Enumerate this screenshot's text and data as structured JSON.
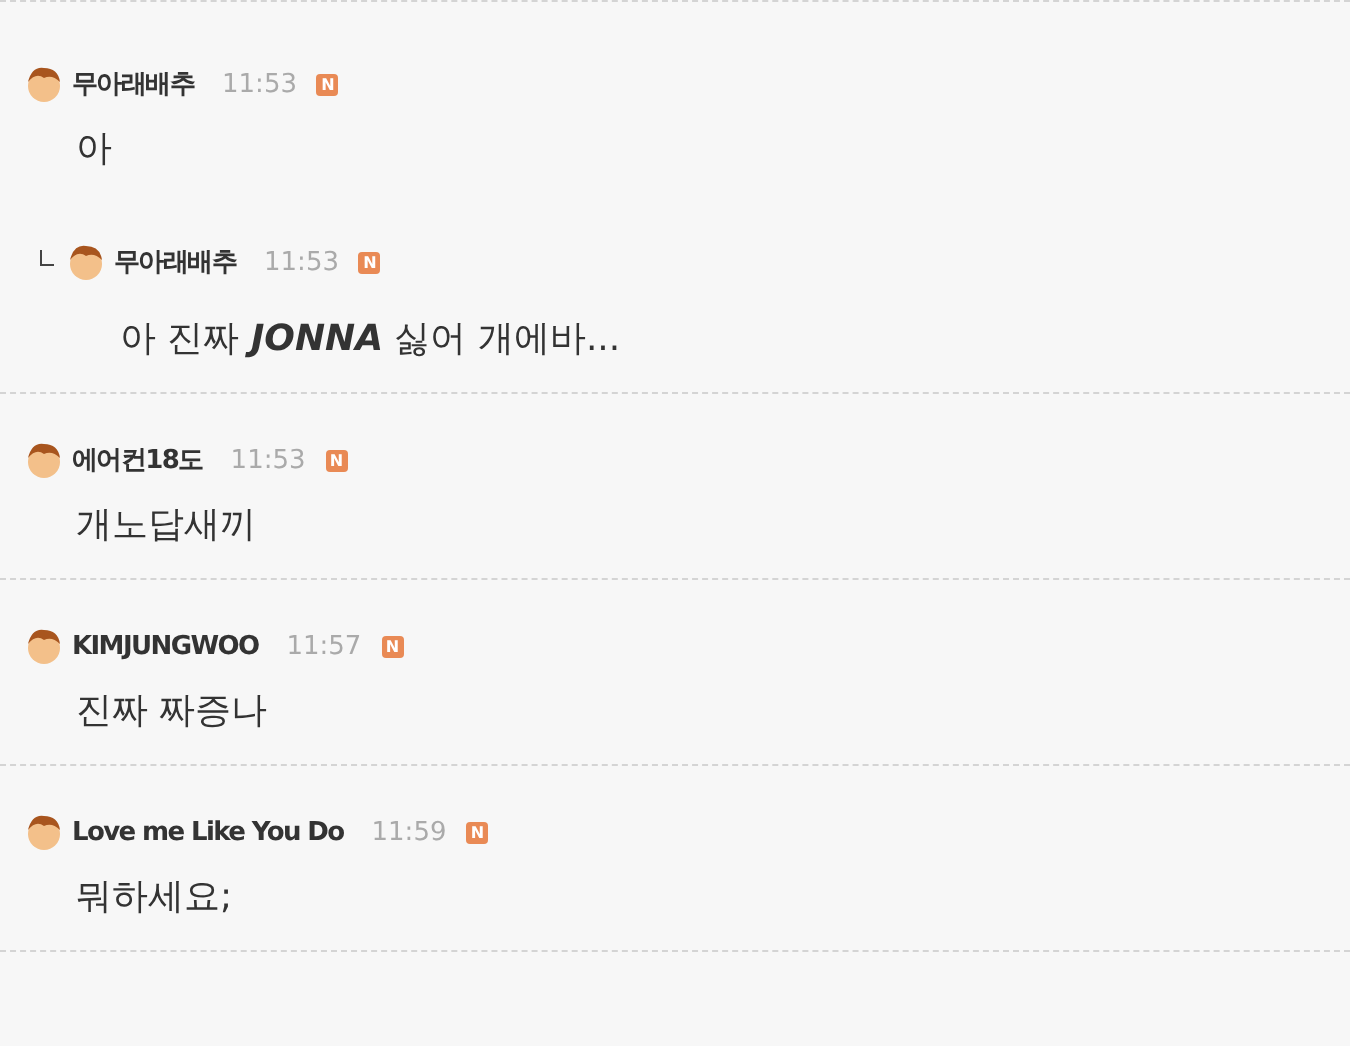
{
  "comments": [
    {
      "author": "무아래배추",
      "time": "11:53",
      "badge": "N",
      "text": "아",
      "replies": [
        {
          "author": "무아래배추",
          "time": "11:53",
          "badge": "N",
          "text": "아 진짜 **JONNA** 싫어 개에바..."
        }
      ]
    },
    {
      "author": "에어컨18도",
      "time": "11:53",
      "badge": "N",
      "text": "개노답새끼"
    },
    {
      "author": "KIMJUNGWOO",
      "time": "11:57",
      "badge": "N",
      "text": "진짜 짜증나"
    },
    {
      "author": "Love me Like You Do",
      "time": "11:59",
      "badge": "N",
      "text": "뭐하세요;"
    }
  ]
}
